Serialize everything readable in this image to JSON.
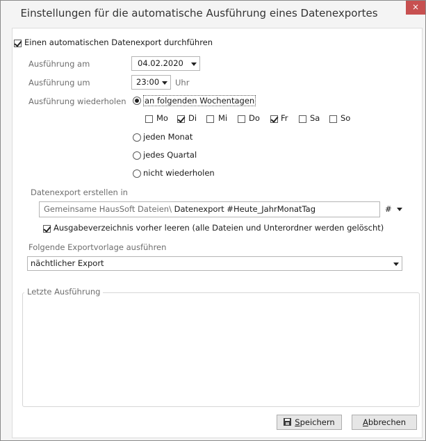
{
  "window": {
    "title": "Einstellungen für die automatische Ausführung eines Datenexportes",
    "close_symbol": "×"
  },
  "auto_export": {
    "label": "Einen automatischen Datenexport durchführen",
    "checked": true
  },
  "execution_date": {
    "label": "Ausführung am",
    "value": "04.02.2020"
  },
  "execution_time": {
    "label": "Ausführung um",
    "value": "23:00",
    "unit": "Uhr"
  },
  "repeat": {
    "label": "Ausführung wiederholen",
    "options": [
      {
        "label": "an folgenden Wochentagen",
        "selected": true
      },
      {
        "label": "jeden Monat",
        "selected": false
      },
      {
        "label": "jedes Quartal",
        "selected": false
      },
      {
        "label": "nicht wiederholen",
        "selected": false
      }
    ],
    "weekdays": [
      {
        "label": "Mo",
        "checked": false
      },
      {
        "label": "Di",
        "checked": true
      },
      {
        "label": "Mi",
        "checked": false
      },
      {
        "label": "Do",
        "checked": false
      },
      {
        "label": "Fr",
        "checked": true
      },
      {
        "label": "Sa",
        "checked": false
      },
      {
        "label": "So",
        "checked": false
      }
    ]
  },
  "export_location": {
    "label": "Datenexport erstellen in",
    "path_prefix": "Gemeinsame HausSoft Dateien\\",
    "path_value": "Datenexport #Heute_JahrMonatTag",
    "hash_button": "#",
    "clear_output_label": "Ausgabeverzeichnis vorher leeren (alle Dateien und Unterordner werden gelöscht)",
    "clear_output_checked": true
  },
  "template": {
    "label": "Folgende Exportvorlage ausführen",
    "value": "nächtlicher Export"
  },
  "last_run": {
    "title": "Letzte Ausführung"
  },
  "buttons": {
    "save_mnemonic": "S",
    "save_rest": "peichern",
    "cancel_mnemonic": "A",
    "cancel_rest": "bbrechen"
  },
  "icons": {
    "save": "floppy-disk-icon",
    "close": "close-icon",
    "dropdown": "chevron-down-icon"
  },
  "colors": {
    "close_button": "#c75050",
    "label_gray": "#6e6e6e",
    "window_bg": "#f4f4f4"
  }
}
